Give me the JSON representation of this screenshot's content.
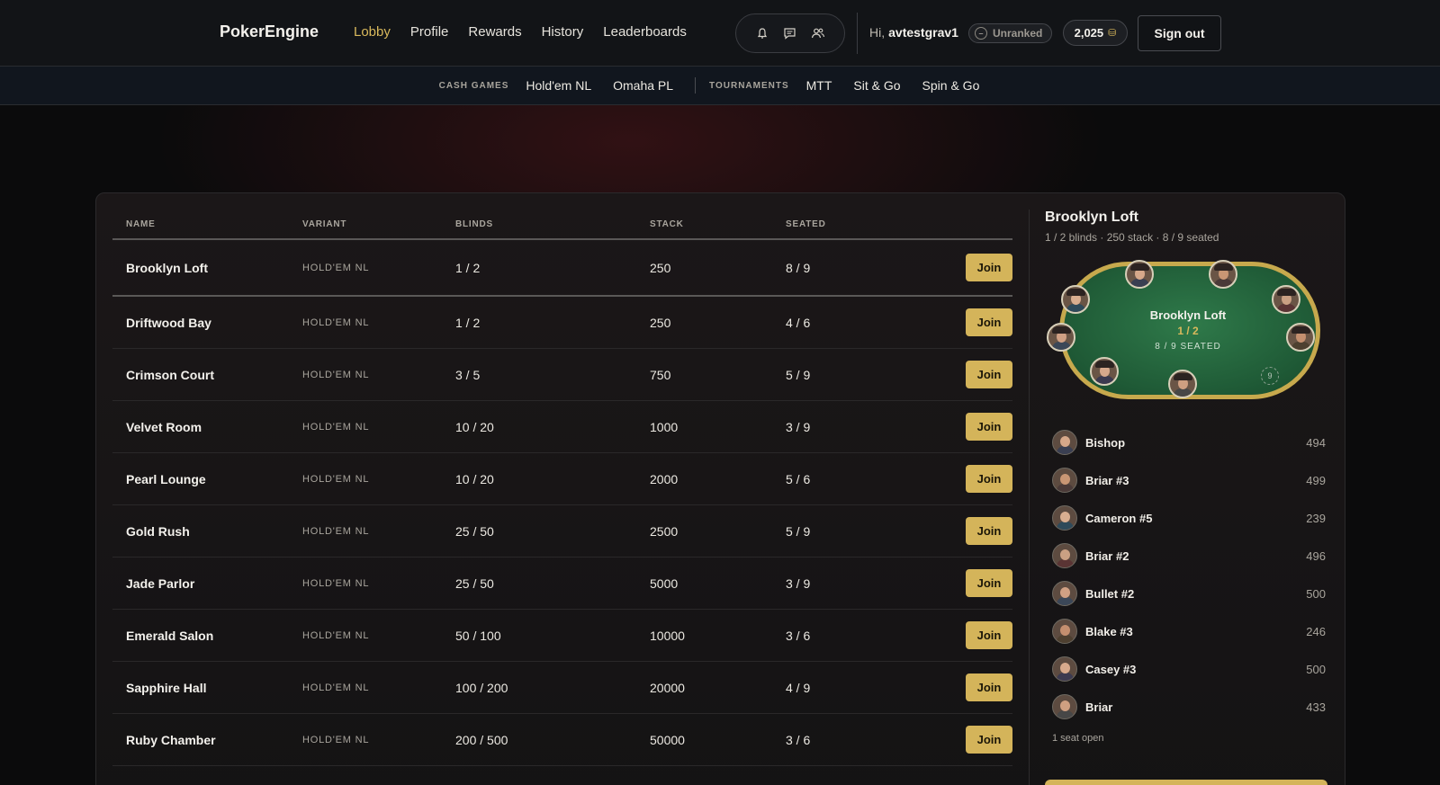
{
  "brand": "PokerEngine",
  "nav": [
    {
      "label": "Lobby",
      "active": true
    },
    {
      "label": "Profile"
    },
    {
      "label": "Rewards"
    },
    {
      "label": "History"
    },
    {
      "label": "Leaderboards"
    }
  ],
  "icons": [
    "bell-icon",
    "chat-icon",
    "friends-icon"
  ],
  "user": {
    "greeting": "Hi,",
    "username": "avtestgrav1",
    "rank": "Unranked",
    "rank_symbol": "–",
    "coins": "2,025",
    "coin_symbol": "⛁",
    "signout": "Sign out"
  },
  "subnav": {
    "cash_label": "CASH GAMES",
    "cash_links": [
      "Hold'em NL",
      "Omaha PL"
    ],
    "tourn_label": "TOURNAMENTS",
    "tourn_links": [
      "MTT",
      "Sit & Go",
      "Spin & Go"
    ]
  },
  "table": {
    "headers": {
      "name": "NAME",
      "variant": "VARIANT",
      "blinds": "BLINDS",
      "stack": "STACK",
      "seated": "SEATED"
    },
    "join_label": "Join",
    "rows": [
      {
        "name": "Brooklyn Loft",
        "variant": "HOLD'EM NL",
        "blinds": "1 / 2",
        "stack": "250",
        "seated": "8 / 9"
      },
      {
        "name": "Driftwood Bay",
        "variant": "HOLD'EM NL",
        "blinds": "1 / 2",
        "stack": "250",
        "seated": "4 / 6"
      },
      {
        "name": "Crimson Court",
        "variant": "HOLD'EM NL",
        "blinds": "3 / 5",
        "stack": "750",
        "seated": "5 / 9"
      },
      {
        "name": "Velvet Room",
        "variant": "HOLD'EM NL",
        "blinds": "10 / 20",
        "stack": "1000",
        "seated": "3 / 9"
      },
      {
        "name": "Pearl Lounge",
        "variant": "HOLD'EM NL",
        "blinds": "10 / 20",
        "stack": "2000",
        "seated": "5 / 6"
      },
      {
        "name": "Gold Rush",
        "variant": "HOLD'EM NL",
        "blinds": "25 / 50",
        "stack": "2500",
        "seated": "5 / 9"
      },
      {
        "name": "Jade Parlor",
        "variant": "HOLD'EM NL",
        "blinds": "25 / 50",
        "stack": "5000",
        "seated": "3 / 9"
      },
      {
        "name": "Emerald Salon",
        "variant": "HOLD'EM NL",
        "blinds": "50 / 100",
        "stack": "10000",
        "seated": "3 / 6"
      },
      {
        "name": "Sapphire Hall",
        "variant": "HOLD'EM NL",
        "blinds": "100 / 200",
        "stack": "20000",
        "seated": "4 / 9"
      },
      {
        "name": "Ruby Chamber",
        "variant": "HOLD'EM NL",
        "blinds": "200 / 500",
        "stack": "50000",
        "seated": "3 / 6"
      }
    ]
  },
  "side": {
    "title": "Brooklyn Loft",
    "subtitle": "1 / 2 blinds · 250 stack · 8 / 9 seated",
    "felt_name": "Brooklyn Loft",
    "felt_blinds": "1 / 2",
    "felt_seated": "8 / 9 SEATED",
    "empty_seat": "9",
    "players": [
      {
        "name": "Bishop",
        "score": "494"
      },
      {
        "name": "Briar #3",
        "score": "499"
      },
      {
        "name": "Cameron #5",
        "score": "239"
      },
      {
        "name": "Briar #2",
        "score": "496"
      },
      {
        "name": "Bullet #2",
        "score": "500"
      },
      {
        "name": "Blake #3",
        "score": "246"
      },
      {
        "name": "Casey #3",
        "score": "500"
      },
      {
        "name": "Briar",
        "score": "433"
      }
    ],
    "open_seats": "1 seat open"
  },
  "colors": {
    "accent": "#d4b45a",
    "felt": "#1f5a36"
  }
}
